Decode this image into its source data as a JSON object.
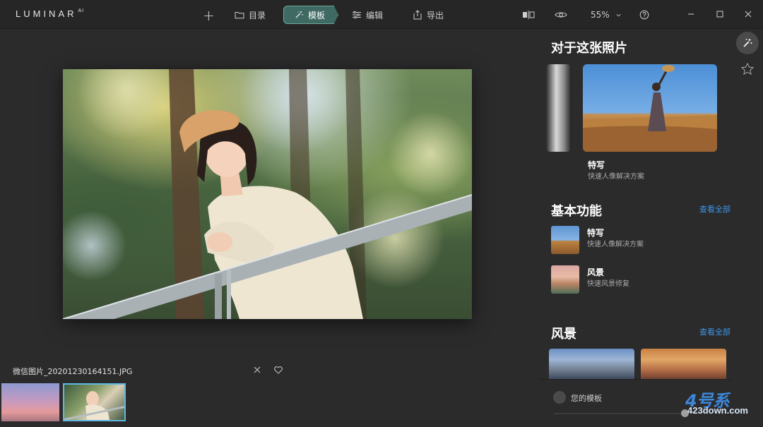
{
  "app": {
    "name": "LUMINAR",
    "name_suffix": "AI"
  },
  "toolbar": {
    "add_label": "+",
    "catalog_label": "目录",
    "templates_label": "模板",
    "edit_label": "编辑",
    "export_label": "导出",
    "zoom_value": "55%"
  },
  "file": {
    "name": "微信图片_20201230164151.JPG"
  },
  "panel": {
    "about_title": "对于这张照片",
    "featured": {
      "label": "特写",
      "sub": "快速人像解决方案"
    },
    "basic_title": "基本功能",
    "basic_see_all": "查看全部",
    "basic_items": [
      {
        "label": "特写",
        "sub": "快速人像解决方案"
      },
      {
        "label": "风景",
        "sub": "快速风景修复"
      }
    ],
    "landscape_title": "风景",
    "landscape_see_all": "查看全部",
    "my_templates_label": "您的模板"
  },
  "watermark": {
    "number": "4号系",
    "url": "423down.com"
  },
  "colors": {
    "accent": "#3f6a63",
    "link": "#3c95e6",
    "selection": "#5fb7e3",
    "background": "#2b2b2c"
  }
}
